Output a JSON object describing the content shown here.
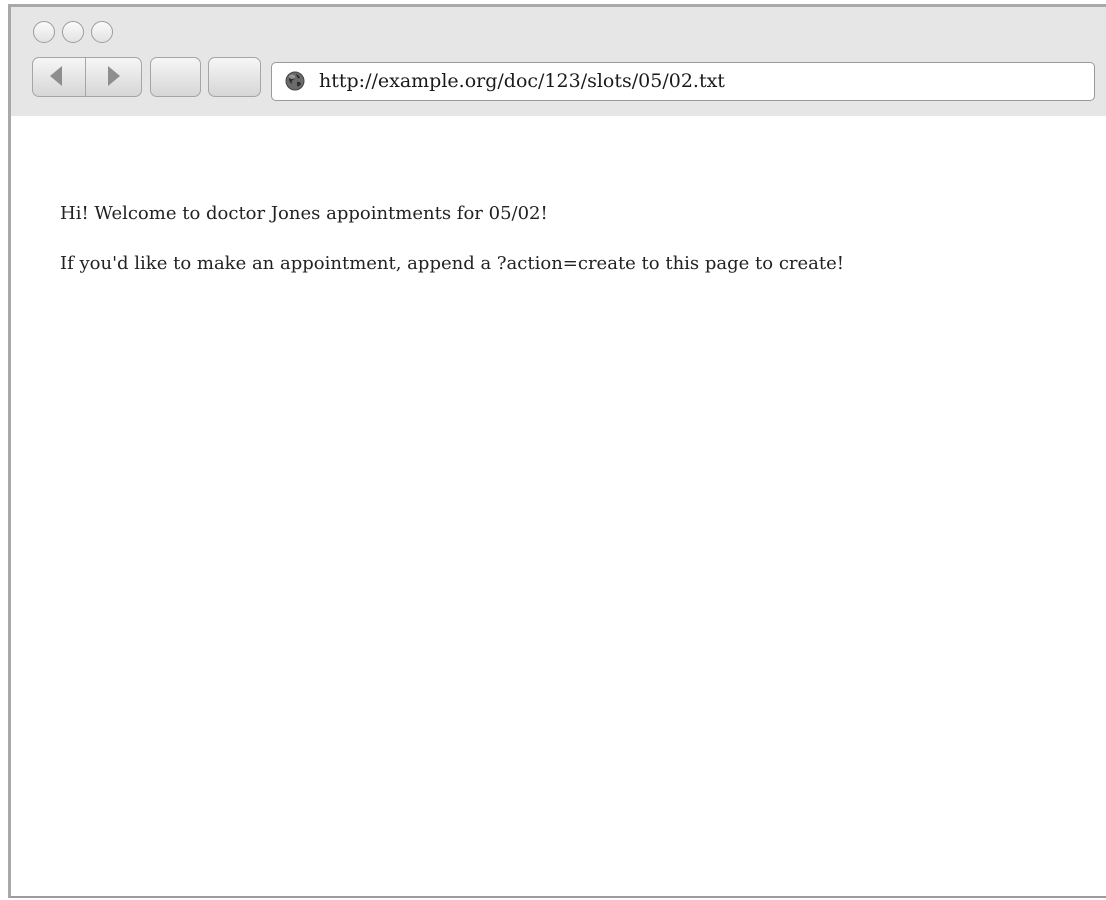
{
  "browser": {
    "url": "http://example.org/doc/123/slots/05/02.txt"
  },
  "page": {
    "lines": [
      "Hi! Welcome to doctor Jones appointments for 05/02!",
      "If you'd like to make an appointment, append a ?action=create to this page to create!"
    ]
  },
  "icons": {
    "back": "left-arrow-icon",
    "forward": "right-arrow-icon",
    "site": "globe-icon"
  },
  "colors": {
    "toolbar": "#e6e6e6",
    "page_background": "#ffffff",
    "text": "#222222"
  }
}
